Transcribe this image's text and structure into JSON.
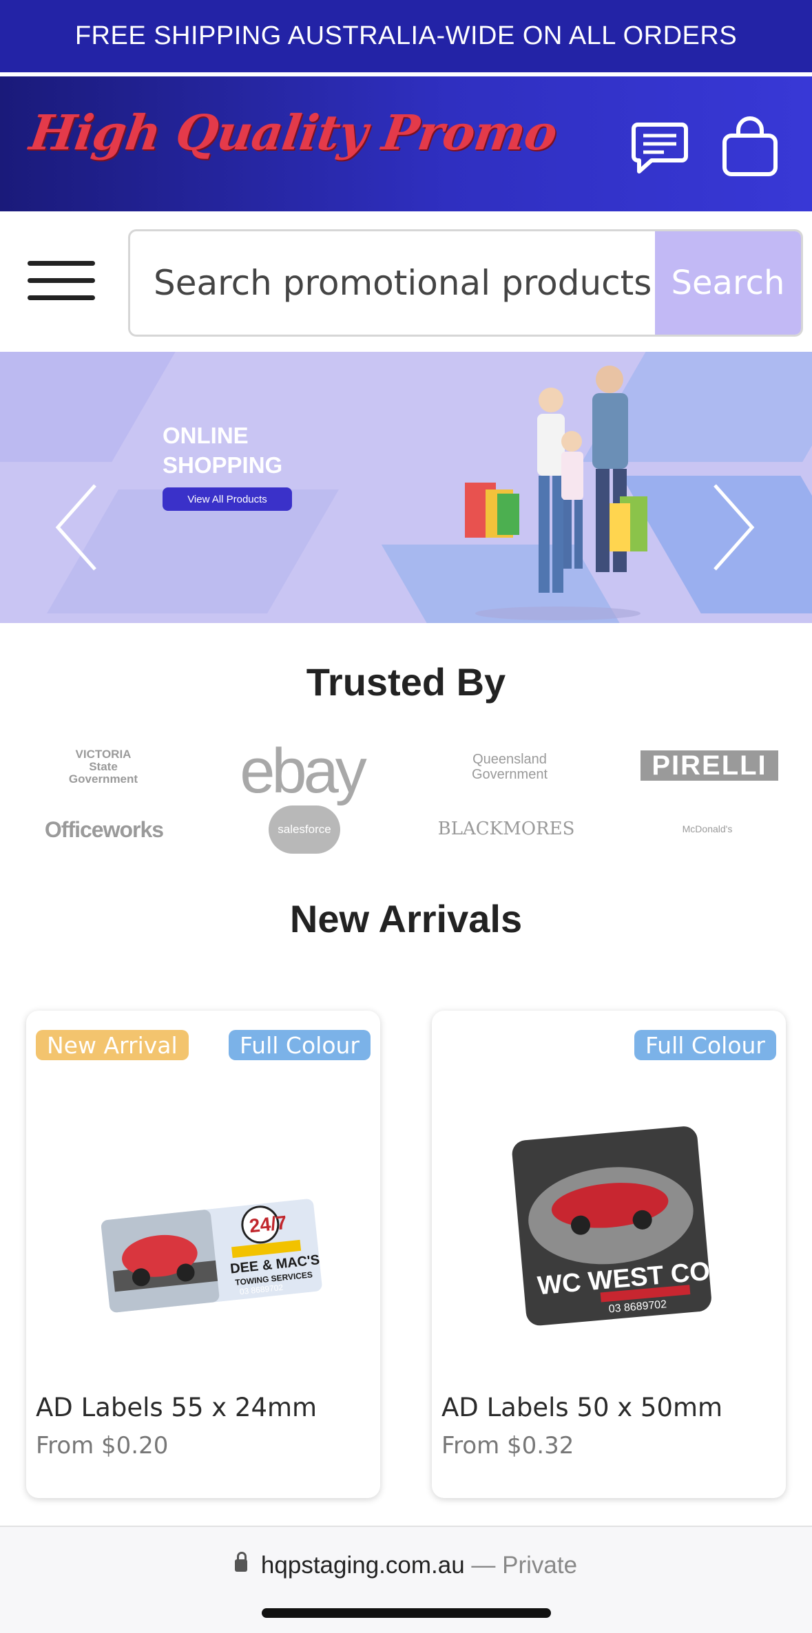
{
  "topbar": {
    "text": "FREE SHIPPING AUSTRALIA-WIDE ON ALL ORDERS"
  },
  "header": {
    "logo_text": "High Quality Promo",
    "icons": [
      "chat-icon",
      "shopping-bag-icon"
    ]
  },
  "search": {
    "placeholder": "Search promotional products",
    "button_label": "Search",
    "menu_icon": "hamburger-menu-icon"
  },
  "banner": {
    "title_line1": "ONLINE",
    "title_line2": "SHOPPING",
    "button_label": "View All Products",
    "prev_icon": "chevron-left-icon",
    "next_icon": "chevron-right-icon"
  },
  "trusted": {
    "title": "Trusted By",
    "brands": [
      "VICTORIA State Government",
      "ebay",
      "Queensland Government",
      "PIRELLI",
      "Officeworks",
      "salesforce",
      "BLACKMORES",
      "McDonald's"
    ]
  },
  "arrivals": {
    "title": "New Arrivals",
    "products": [
      {
        "badges": [
          "New Arrival",
          "Full Colour"
        ],
        "name": "AD Labels 55 x 24mm",
        "price": "From $0.20"
      },
      {
        "badges": [
          "Full Colour"
        ],
        "name": "AD Labels 50 x 50mm",
        "price": "From $0.32"
      }
    ]
  },
  "browser": {
    "domain": "hqpstaging.com.au",
    "mode": "— Private"
  },
  "colors": {
    "brand_blue": "#2323a6",
    "logo_red": "#e43a4a",
    "search_button": "#c2b9f5",
    "badge_new": "#f3c46e",
    "badge_colour": "#7bb2e8"
  }
}
